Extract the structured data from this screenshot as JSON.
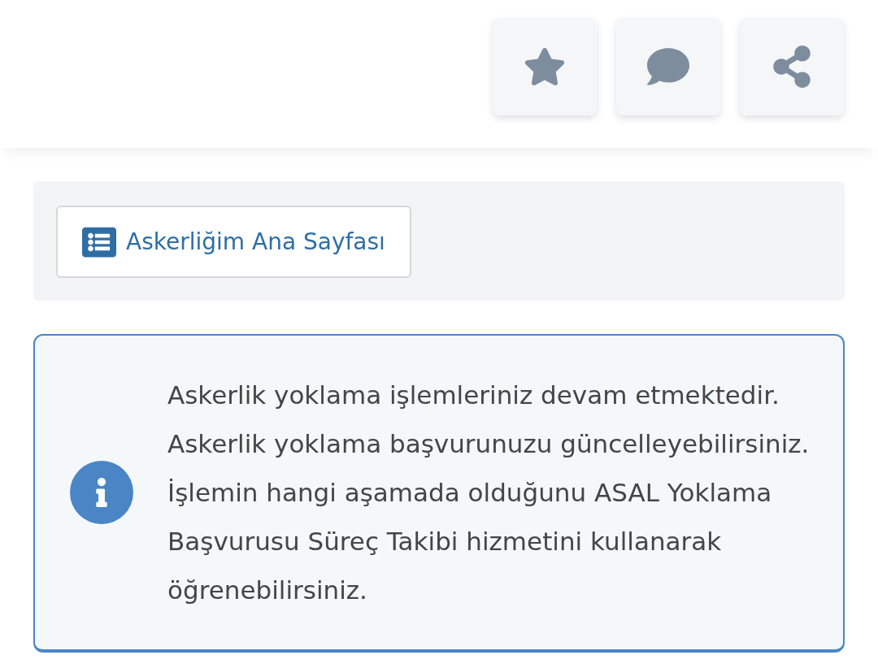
{
  "header": {
    "actions": [
      {
        "kind": "favorite"
      },
      {
        "kind": "comment"
      },
      {
        "kind": "share"
      }
    ]
  },
  "nav": {
    "button": "Askerliğim Ana Sayfası"
  },
  "info": {
    "text": "Askerlik yoklama işlemleriniz devam etmektedir. Askerlik yoklama başvurunuzu güncelleyebilirsiniz. İşlemin hangi aşamada olduğunu ASAL Yoklama Başvurusu Süreç Takibi hizmetini kullanarak öğrenebilirsiniz."
  }
}
